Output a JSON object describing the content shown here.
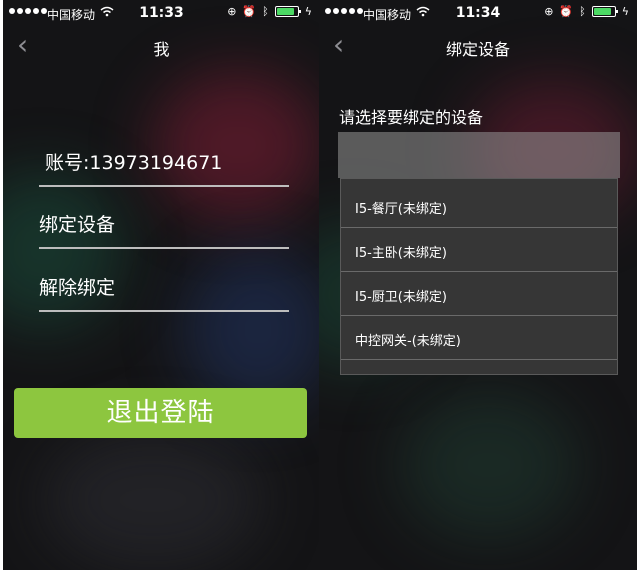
{
  "left_screen": {
    "status_bar": {
      "carrier": "中国移动",
      "time": "11:33",
      "icons": [
        "signal-dots-icon",
        "wifi-icon",
        "orientation-lock-icon",
        "alarm-icon",
        "bluetooth-icon",
        "battery-icon",
        "charging-icon"
      ],
      "battery_level": 0.85
    },
    "nav": {
      "back_icon": "chevron-left-icon",
      "title": "我"
    },
    "account_label": "账号:13973194671",
    "bind_device_label": "绑定设备",
    "unbind_label": "解除绑定",
    "logout_button_label": "退出登陆",
    "colors": {
      "button": "#8dc63f",
      "divider": "#bdbdbd"
    }
  },
  "right_screen": {
    "status_bar": {
      "carrier": "中国移动",
      "time": "11:34",
      "icons": [
        "signal-dots-icon",
        "wifi-icon",
        "orientation-lock-icon",
        "alarm-icon",
        "bluetooth-icon",
        "battery-icon",
        "charging-icon"
      ],
      "battery_level": 0.85
    },
    "nav": {
      "back_icon": "chevron-left-icon",
      "title": "绑定设备"
    },
    "prompt": "请选择要绑定的设备",
    "device_options": [
      {
        "label": "I5-餐厅(未绑定)"
      },
      {
        "label": "I5-主卧(未绑定)"
      },
      {
        "label": "I5-厨卫(未绑定)"
      },
      {
        "label": "中控网关-(未绑定)"
      }
    ]
  }
}
